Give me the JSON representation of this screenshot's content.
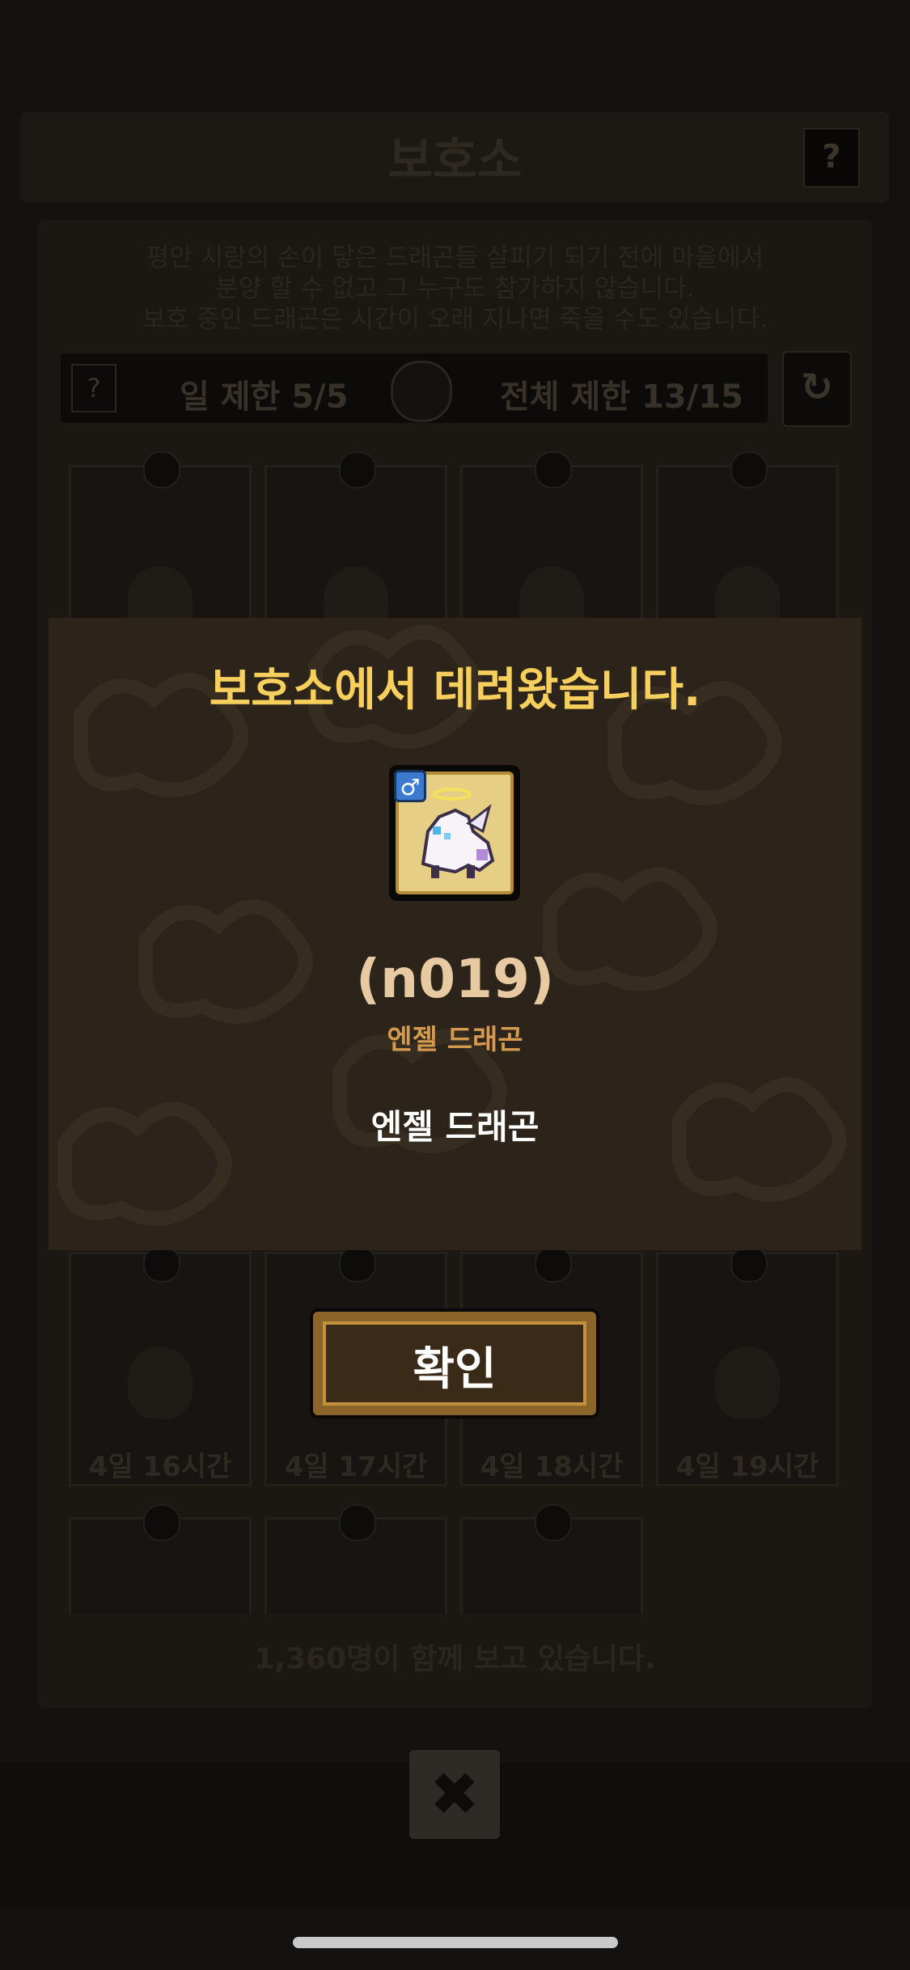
{
  "header": {
    "title": "보호소",
    "help_icon": "question-icon",
    "help_label": "?"
  },
  "notice": {
    "lines": [
      "평안 시랑의 손이 닿은 드래곤들 살피기 되기 전에 마을에서",
      "분양 할 수 없고 그 누구도 참가하지 않습니다.",
      "보호 중인 드래곤은 시간이 오래 지나면 죽을 수도 있습니다."
    ]
  },
  "limits": {
    "help_label": "?",
    "daily_label": "일 제한",
    "daily_value": "5/5",
    "total_label": "전체 제한",
    "total_value": "13/15",
    "refresh_icon": "refresh-icon",
    "refresh_glyph": "↻"
  },
  "slots": {
    "row3": [
      "4일 16시간",
      "4일 17시간",
      "4일 18시간",
      "4일 19시간"
    ]
  },
  "watching_text": "1,360명이 함께 보고 있습니다.",
  "close": {
    "icon": "close-icon",
    "glyph": "✖"
  },
  "popup": {
    "title": "보호소에서 데려왔습니다.",
    "gender_icon": "male-icon",
    "gender_glyph": "♂",
    "code": "(n019)",
    "subname": "엔젤 드래곤",
    "name": "엔젤 드래곤",
    "confirm_label": "확인"
  },
  "colors": {
    "title_gold": "#f6cf5c",
    "popup_bg": "#2c241b",
    "subname": "#d49a4e",
    "button_frame": "#c4923f"
  }
}
